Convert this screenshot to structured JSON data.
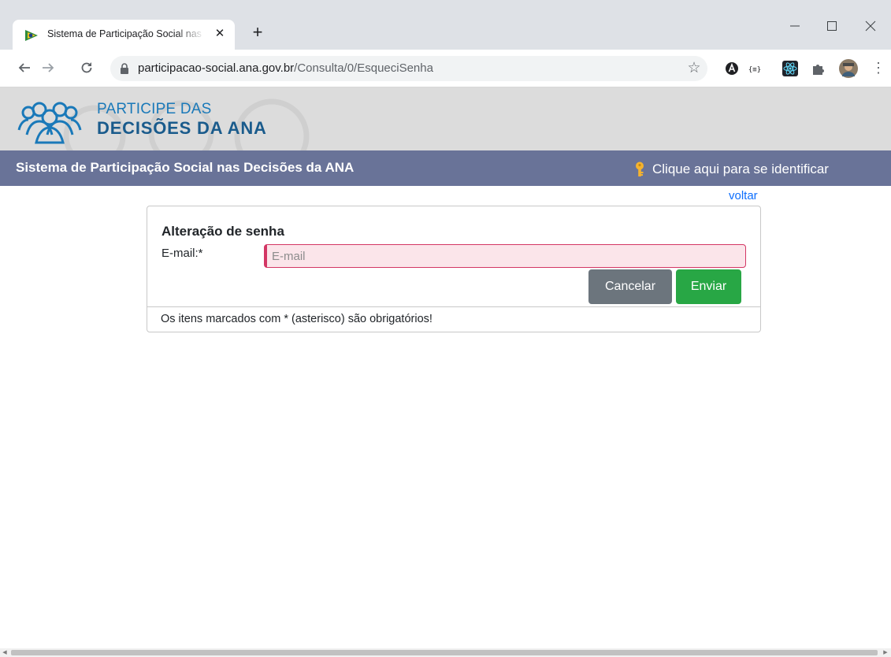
{
  "browser": {
    "tab_title": "Sistema de Participação Social nas Decisões da ANA",
    "tab_close": "✕",
    "new_tab": "+",
    "url_host": "participacao-social.ana.gov.br",
    "url_path": "/Consulta/0/EsqueciSenha",
    "extensions": [
      "angular-icon",
      "json-viewer-icon",
      "react-devtools-icon",
      "puzzle-icon",
      "profile-avatar"
    ]
  },
  "header": {
    "logo_line1": "PARTICIPE DAS",
    "logo_line2": "DECISÕES DA ANA"
  },
  "nav": {
    "title": "Sistema de Participação Social nas Decisões da ANA",
    "login_label": "Clique aqui para se identificar"
  },
  "content": {
    "back_label": "voltar",
    "card_title": "Alteração de senha",
    "email_label": "E-mail:*",
    "email_placeholder": "E-mail",
    "email_value": "",
    "cancel_label": "Cancelar",
    "send_label": "Enviar",
    "footer_note": "Os itens marcados com * (asterisco) são obrigatórios!"
  },
  "colors": {
    "nav_bg": "#697398",
    "header_bg": "#dcdcdc",
    "logo_blue": "#1a79b9",
    "cancel_bg": "#6c757d",
    "send_bg": "#28a745",
    "invalid_border": "#d33664",
    "link": "#0d6efd"
  }
}
